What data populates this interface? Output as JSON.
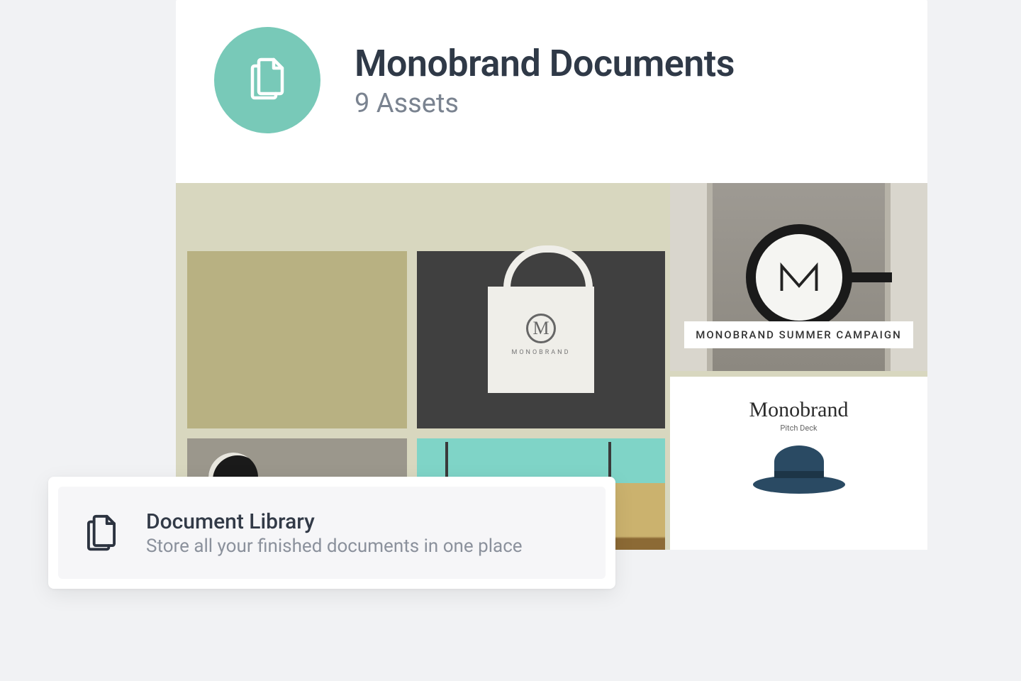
{
  "library": {
    "title": "Monobrand Documents",
    "asset_count_label": "9 Assets"
  },
  "assets": {
    "tote_brand": "MONOBRAND",
    "campaign_banner": "MONOBRAND SUMMER CAMPAIGN",
    "pitch_title": "Monobrand",
    "pitch_subtitle": "Pitch Deck"
  },
  "feature_card": {
    "title": "Document Library",
    "description": "Store all your finished documents in one place"
  },
  "colors": {
    "accent_teal": "#78c9b8",
    "text_primary": "#2f3947",
    "text_secondary": "#7a8390"
  }
}
